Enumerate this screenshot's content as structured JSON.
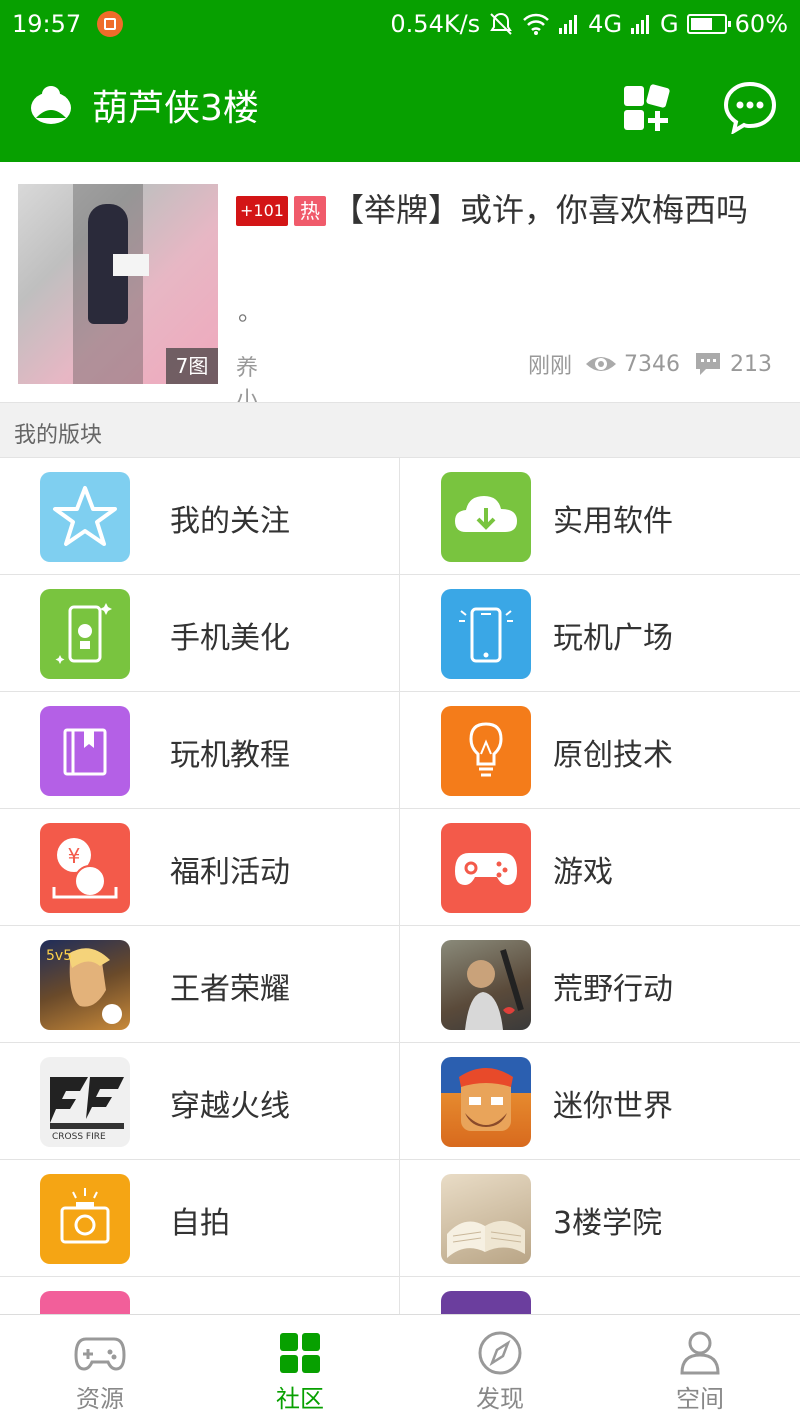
{
  "status": {
    "time": "19:57",
    "speed": "0.54K/s",
    "network": "4G",
    "network2": "G",
    "battery": "60%"
  },
  "appbar": {
    "title": "葫芦侠3楼"
  },
  "post": {
    "image_count": "7图",
    "tag_plus": "+101",
    "tag_hot": "热",
    "title": "【举牌】或许，你喜欢梅西吗",
    "excerpt": "。",
    "author": "养小鬼",
    "time": "刚刚",
    "views": "7346",
    "comments": "213"
  },
  "section": {
    "title": "我的版块"
  },
  "forums": [
    {
      "label": "我的关注",
      "icon": "star-icon",
      "color": "#7fcff0"
    },
    {
      "label": "实用软件",
      "icon": "cloud-download-icon",
      "color": "#79c43f"
    },
    {
      "label": "手机美化",
      "icon": "phone-flower-icon",
      "color": "#79c43f"
    },
    {
      "label": "玩机广场",
      "icon": "phone-icon",
      "color": "#3aa7e6"
    },
    {
      "label": "玩机教程",
      "icon": "book-icon",
      "color": "#b460e6"
    },
    {
      "label": "原创技术",
      "icon": "bulb-icon",
      "color": "#f47c1a"
    },
    {
      "label": "福利活动",
      "icon": "welfare-icon",
      "color": "#f35a4a"
    },
    {
      "label": "游戏",
      "icon": "gamepad-icon",
      "color": "#f35a4a"
    },
    {
      "label": "王者荣耀",
      "icon": "honor-of-kings-icon",
      "color": "#2a3a6a"
    },
    {
      "label": "荒野行动",
      "icon": "knives-out-icon",
      "color": "#5a5a4a"
    },
    {
      "label": "穿越火线",
      "icon": "crossfire-icon",
      "color": "#f0f0f0"
    },
    {
      "label": "迷你世界",
      "icon": "mini-world-icon",
      "color": "#e68a2e"
    },
    {
      "label": "自拍",
      "icon": "camera-icon",
      "color": "#f5a514"
    },
    {
      "label": "3楼学院",
      "icon": "open-book-icon",
      "color": "#c9b79a"
    },
    {
      "label": "",
      "icon": "pink-forum-icon",
      "color": "#f25f9a"
    },
    {
      "label": "",
      "icon": "purple-forum-icon",
      "color": "#6b3e9e"
    }
  ],
  "nav": {
    "tab1": "资源",
    "tab2": "社区",
    "tab3": "发现",
    "tab4": "空间"
  },
  "colors": {
    "brand": "#07a000",
    "active_tab": "#07a000"
  }
}
